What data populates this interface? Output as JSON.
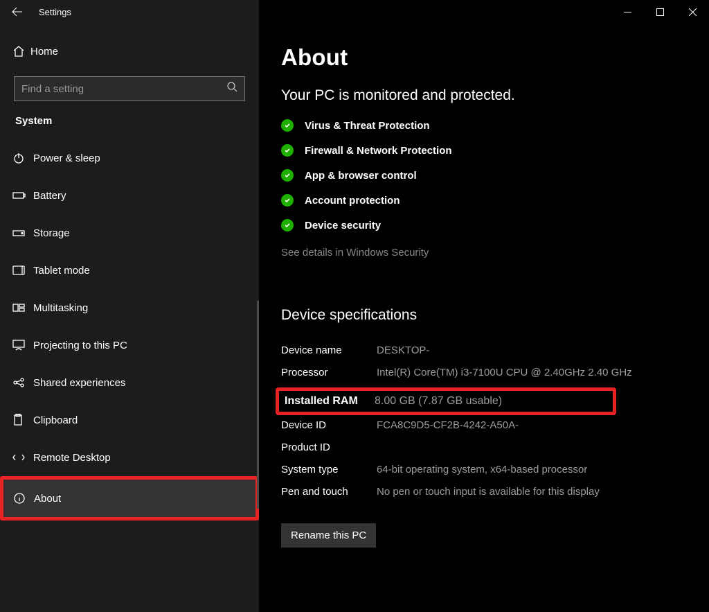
{
  "window": {
    "title": "Settings"
  },
  "sidebar": {
    "home": "Home",
    "search_placeholder": "Find a setting",
    "section": "System",
    "items": [
      {
        "label": "Power & sleep"
      },
      {
        "label": "Battery"
      },
      {
        "label": "Storage"
      },
      {
        "label": "Tablet mode"
      },
      {
        "label": "Multitasking"
      },
      {
        "label": "Projecting to this PC"
      },
      {
        "label": "Shared experiences"
      },
      {
        "label": "Clipboard"
      },
      {
        "label": "Remote Desktop"
      },
      {
        "label": "About"
      }
    ]
  },
  "main": {
    "title": "About",
    "security_heading": "Your PC is monitored and protected.",
    "security_items": [
      "Virus & Threat Protection",
      "Firewall & Network Protection",
      "App & browser control",
      "Account protection",
      "Device security"
    ],
    "see_details": "See details in Windows Security",
    "spec_heading": "Device specifications",
    "specs": {
      "device_name_label": "Device name",
      "device_name_value": "DESKTOP-",
      "processor_label": "Processor",
      "processor_value": "Intel(R) Core(TM) i3-7100U CPU @ 2.40GHz   2.40 GHz",
      "ram_label": "Installed RAM",
      "ram_value": "8.00 GB (7.87 GB usable)",
      "device_id_label": "Device ID",
      "device_id_value": "FCA8C9D5-CF2B-4242-A50A-",
      "product_id_label": "Product ID",
      "product_id_value": "",
      "system_type_label": "System type",
      "system_type_value": "64-bit operating system, x64-based processor",
      "pen_touch_label": "Pen and touch",
      "pen_touch_value": "No pen or touch input is available for this display"
    },
    "rename_button": "Rename this PC"
  }
}
